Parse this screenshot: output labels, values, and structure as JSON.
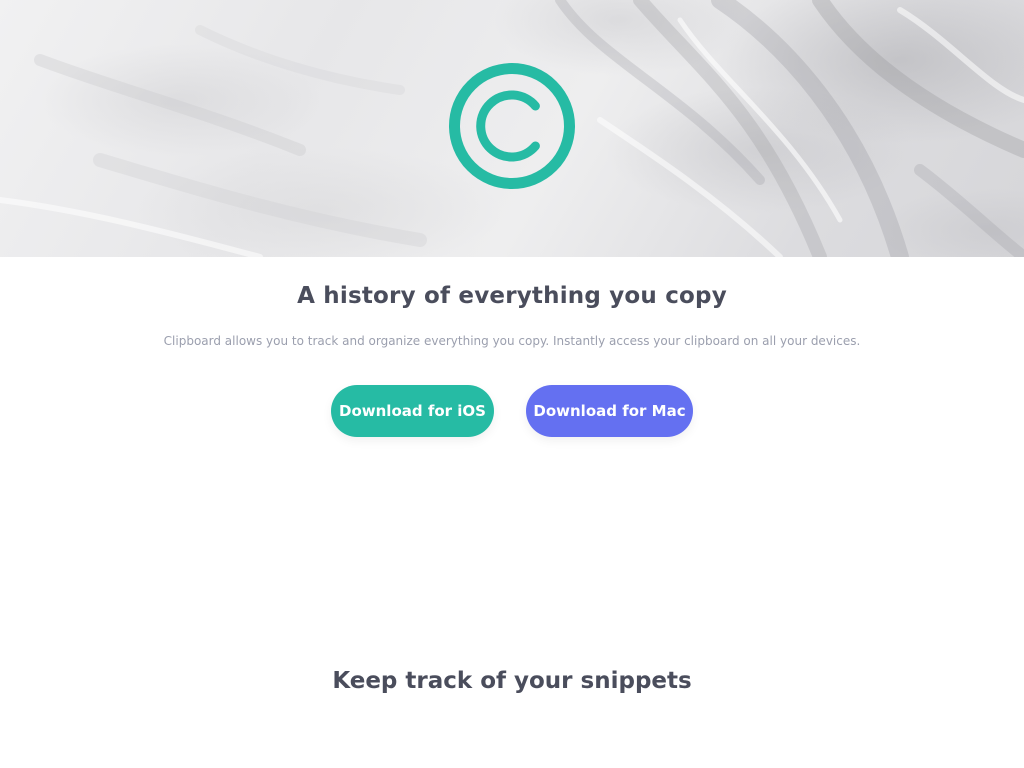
{
  "hero": {
    "logo_icon": "copyright-c-icon",
    "brand_color": "#26bba4"
  },
  "intro": {
    "headline": "A history of everything you copy",
    "subtext": "Clipboard allows you to track and organize everything you copy. Instantly access your clipboard on all your devices."
  },
  "buttons": {
    "ios_label": "Download for iOS",
    "ios_color": "#26bba4",
    "mac_label": "Download for Mac",
    "mac_color": "#6470f1"
  },
  "snippets": {
    "title": "Keep track of your snippets"
  }
}
